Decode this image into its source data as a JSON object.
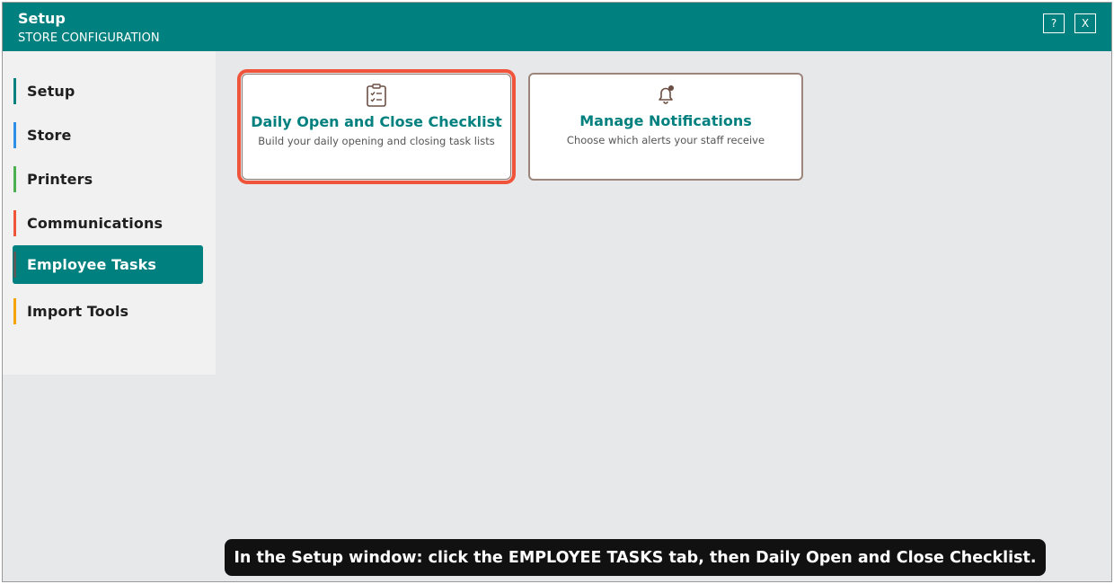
{
  "window": {
    "title": "Setup",
    "subtitle": "STORE CONFIGURATION",
    "help_label": "?",
    "close_label": "X"
  },
  "sidebar": {
    "items": [
      {
        "label": "Setup",
        "color": "#00807e",
        "active": false
      },
      {
        "label": "Store",
        "color": "#2e8fe6",
        "active": false
      },
      {
        "label": "Printers",
        "color": "#4caf50",
        "active": false
      },
      {
        "label": "Communications",
        "color": "#f0543a",
        "active": false
      },
      {
        "label": "Employee Tasks",
        "color": "#5a5a5a",
        "active": true
      },
      {
        "label": "Import Tools",
        "color": "#f5a300",
        "active": false
      }
    ]
  },
  "cards": [
    {
      "icon": "clipboard-checklist-icon",
      "title": "Daily Open and Close Checklist",
      "description": "Build your daily opening and closing task lists",
      "highlighted": true
    },
    {
      "icon": "bell-notification-icon",
      "title": "Manage Notifications",
      "description": "Choose which alerts your staff receive",
      "highlighted": false
    }
  ],
  "instruction": "In the Setup window: click the EMPLOYEE TASKS tab, then Daily Open and Close Checklist.",
  "colors": {
    "accent": "#00807e",
    "highlight": "#f0543a",
    "icon": "#6b4f44"
  }
}
